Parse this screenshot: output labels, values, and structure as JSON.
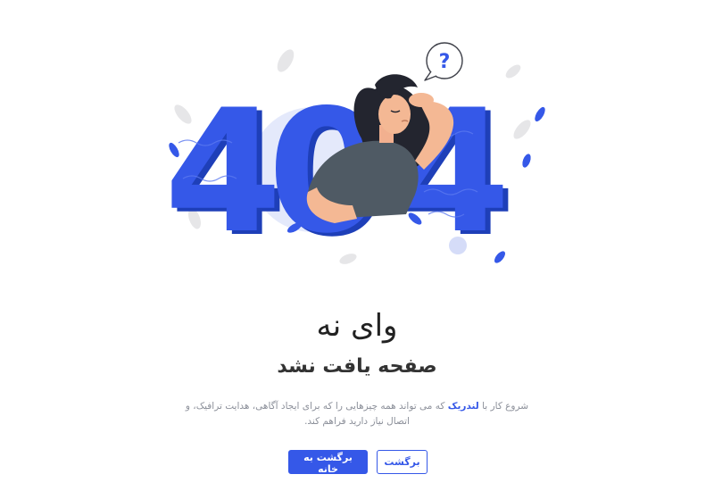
{
  "illustration": {
    "digits": [
      "4",
      "0",
      "4"
    ],
    "question_mark": "?",
    "accent_color": "#3558e8"
  },
  "heading": {
    "title": "وای نه",
    "subtitle": "صفحه یافت نشد"
  },
  "description": {
    "before": "شروع کار با ",
    "brand": "لندریک",
    "after": " که می تواند همه چیزهایی را که برای ایجاد آگاهی، هدایت ترافیک، و اتصال نیاز دارید فراهم کند."
  },
  "buttons": {
    "home": "برگشت به خانه",
    "back": "برگشت"
  }
}
